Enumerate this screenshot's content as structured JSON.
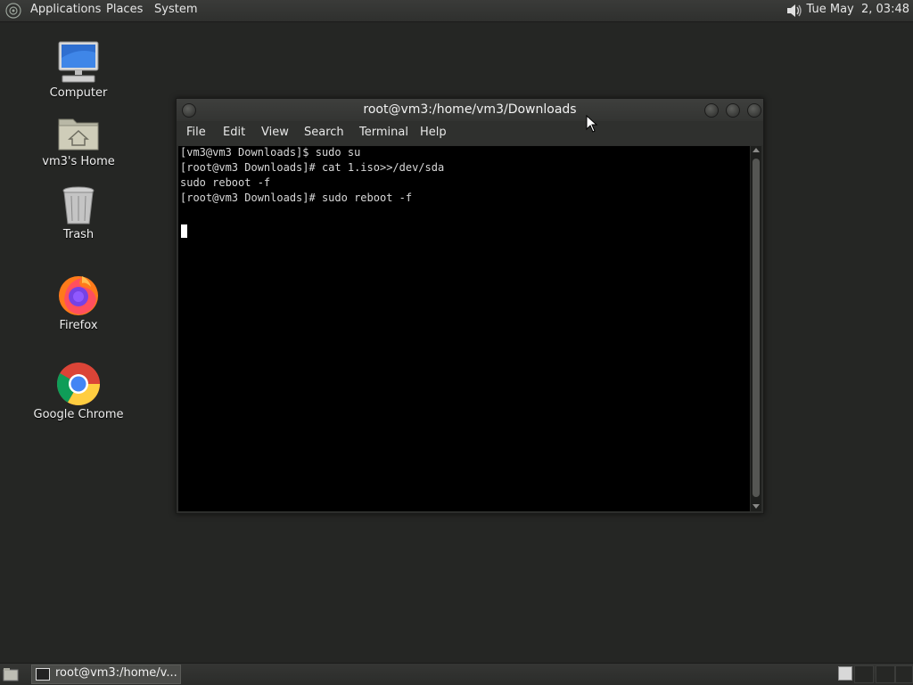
{
  "top_panel": {
    "menus": [
      "Applications",
      "Places",
      "System"
    ],
    "clock": "Tue May  2, 03:48"
  },
  "desktop_icons": [
    {
      "label": "Computer",
      "icon": "computer-icon"
    },
    {
      "label": "vm3's Home",
      "icon": "home-folder-icon"
    },
    {
      "label": "Trash",
      "icon": "trash-icon"
    },
    {
      "label": "Firefox",
      "icon": "firefox-icon"
    },
    {
      "label": "Google Chrome",
      "icon": "chrome-icon"
    }
  ],
  "terminal": {
    "title": "root@vm3:/home/vm3/Downloads",
    "menu": [
      "File",
      "Edit",
      "View",
      "Search",
      "Terminal",
      "Help"
    ],
    "lines": [
      "[vm3@vm3 Downloads]$ sudo su",
      "[root@vm3 Downloads]# cat 1.iso>>/dev/sda",
      "sudo reboot -f",
      "[root@vm3 Downloads]# sudo reboot -f"
    ]
  },
  "taskbar": {
    "window_button": "root@vm3:/home/v..."
  },
  "colors": {
    "desktop_bg": "#252624",
    "terminal_bg": "#000000",
    "terminal_fg": "#d8d8d8"
  }
}
